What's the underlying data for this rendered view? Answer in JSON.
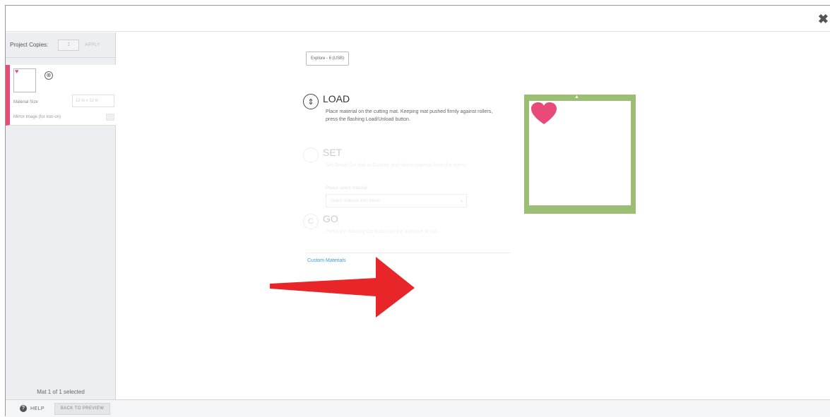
{
  "titlebar": {
    "close_icon": "close-icon"
  },
  "sidebar": {
    "copies_label": "Project Copies:",
    "copies_value": "1",
    "apply_label": "APPLY",
    "mat": {
      "size_label": "Material Size",
      "size_value": "12 in x 12 in",
      "mirror_label": "Mirror Image (for iron-on)",
      "icon": "link-icon"
    },
    "mat_count": "Mat 1 of 1 selected"
  },
  "main": {
    "device_button": "Explore - 6 (USB)",
    "steps": [
      {
        "title": "LOAD",
        "description": "Place material on the cutting mat. Keeping mat pushed firmly against rollers, press the flashing Load/Unload button.",
        "icon": "load-arrows-icon"
      },
      {
        "title": "SET",
        "description": "Set Smart Set dial to Custom and select material from the menu.",
        "icon": "set-dial-icon"
      },
      {
        "title": "GO",
        "description": "Press the flashing Go button on the machine to cut.",
        "icon": "go-icon",
        "icon_glyph": "C"
      }
    ],
    "material_label": "Please select material",
    "material_placeholder": "Select material from menu",
    "custom_materials_link": "Custom Materials"
  },
  "mat_preview": {
    "mat_color": "#9bbd74",
    "heart_color": "#e84a7a"
  },
  "annotation_arrow": {
    "color": "#e8262a"
  },
  "footer": {
    "help_label": "HELP",
    "back_label": "BACK TO PREVIEW"
  }
}
